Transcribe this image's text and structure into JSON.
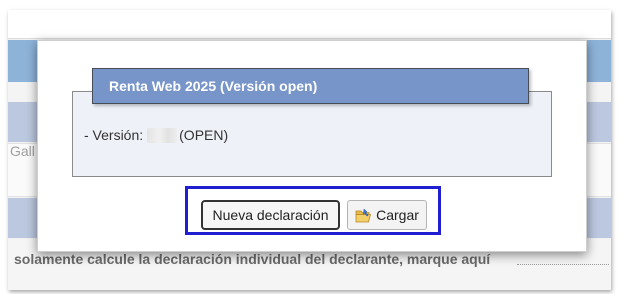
{
  "background": {
    "side_label": "Gall",
    "footer_text": "solamente calcule la declaración individual del declarante, marque aquí"
  },
  "dialog": {
    "title": "Renta Web 2025 (Versión open)",
    "version_prefix": "- Versión:",
    "version_suffix": "(OPEN)"
  },
  "buttons": {
    "new_declaration": "Nueva declaración",
    "load": "Cargar",
    "load_icon": "folder-open-icon"
  },
  "colors": {
    "title_bar": "#7895c9",
    "highlight_border": "#1f1fd1"
  }
}
